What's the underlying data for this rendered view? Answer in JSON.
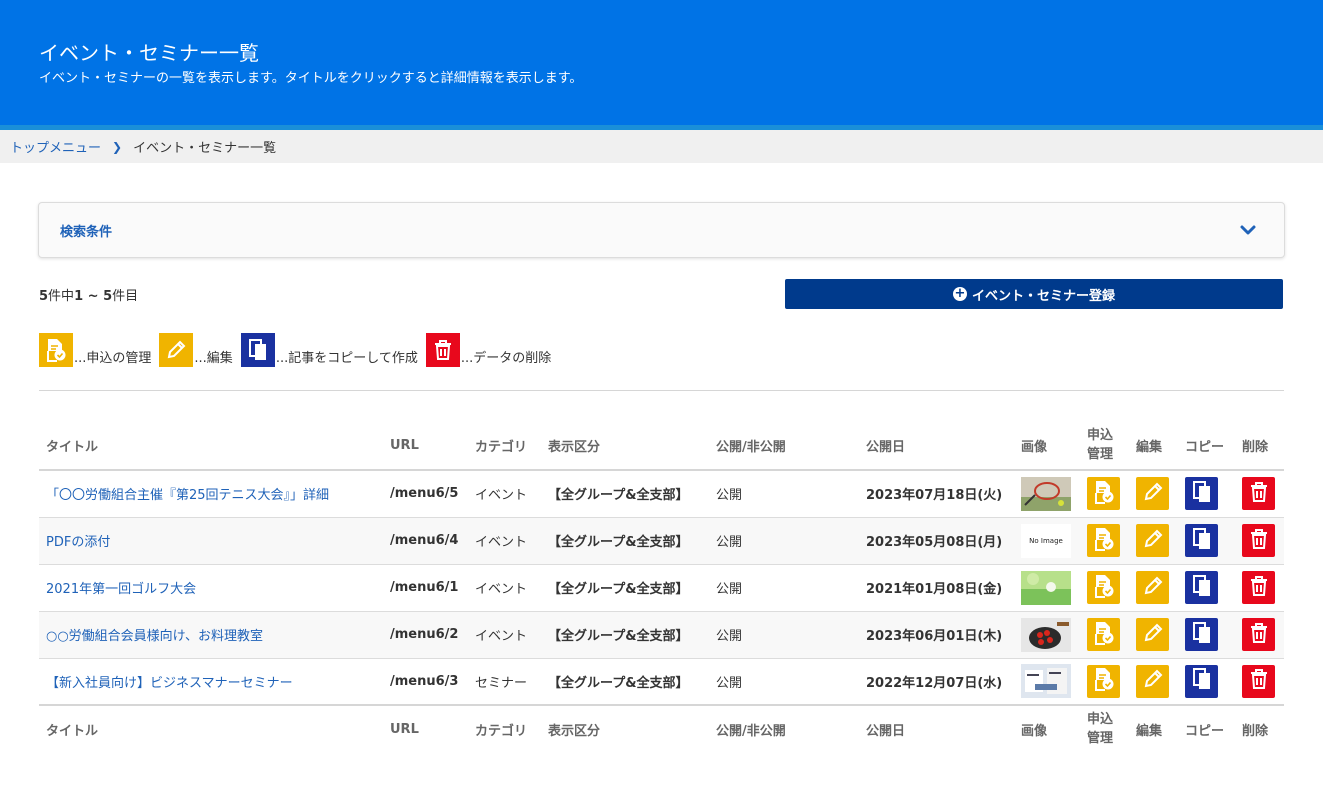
{
  "header": {
    "title": "イベント・セミナー一覧",
    "description": "イベント・セミナーの一覧を表示します。タイトルをクリックすると詳細情報を表示します。"
  },
  "breadcrumb": {
    "home": "トップメニュー",
    "current": "イベント・セミナー一覧"
  },
  "search": {
    "label": "検索条件",
    "icon": "chevron-down-icon"
  },
  "count": {
    "total": "5",
    "total_suffix": "件中",
    "from": "1",
    "sep": " ~ ",
    "to": "5",
    "to_suffix": "件目"
  },
  "register_button": "イベント・セミナー登録",
  "legend": [
    {
      "icon": "application-icon",
      "text": "...申込の管理"
    },
    {
      "icon": "pencil-icon",
      "text": "...編集"
    },
    {
      "icon": "copy-icon",
      "text": "...記事をコピーして作成"
    },
    {
      "icon": "trash-icon",
      "text": "...データの削除"
    }
  ],
  "columns": {
    "title": "タイトル",
    "url": "URL",
    "category": "カテゴリ",
    "kubun": "表示区分",
    "publish": "公開/非公開",
    "date": "公開日",
    "image": "画像",
    "apply_1": "申込",
    "apply_2": "管理",
    "edit": "編集",
    "copy": "コピー",
    "delete": "削除"
  },
  "rows": [
    {
      "title": "「〇〇労働組合主催『第25回テニス大会』」詳細",
      "url": "/menu6/5",
      "category": "イベント",
      "kubun": "【全グループ&全支部】",
      "publish": "公開",
      "date": "2023年07月18日(火)",
      "image": "tennis"
    },
    {
      "title": "PDFの添付",
      "url": "/menu6/4",
      "category": "イベント",
      "kubun": "【全グループ&全支部】",
      "publish": "公開",
      "date": "2023年05月08日(月)",
      "image": "noimage",
      "noimage_text": "No Image"
    },
    {
      "title": "2021年第一回ゴルフ大会",
      "url": "/menu6/1",
      "category": "イベント",
      "kubun": "【全グループ&全支部】",
      "publish": "公開",
      "date": "2021年01月08日(金)",
      "image": "golf"
    },
    {
      "title": "○○労働組合会員様向け、お料理教室",
      "url": "/menu6/2",
      "category": "イベント",
      "kubun": "【全グループ&全支部】",
      "publish": "公開",
      "date": "2023年06月01日(木)",
      "image": "cooking"
    },
    {
      "title": "【新入社員向け】ビジネスマナーセミナー",
      "url": "/menu6/3",
      "category": "セミナー",
      "kubun": "【全グループ&全支部】",
      "publish": "公開",
      "date": "2022年12月07日(水)",
      "image": "business"
    }
  ],
  "colors": {
    "header": "#0073e6",
    "register": "#003a8c",
    "yellow": "#f0b400",
    "blue": "#1a31a0",
    "red": "#e8081c",
    "link": "#1f62b8"
  }
}
